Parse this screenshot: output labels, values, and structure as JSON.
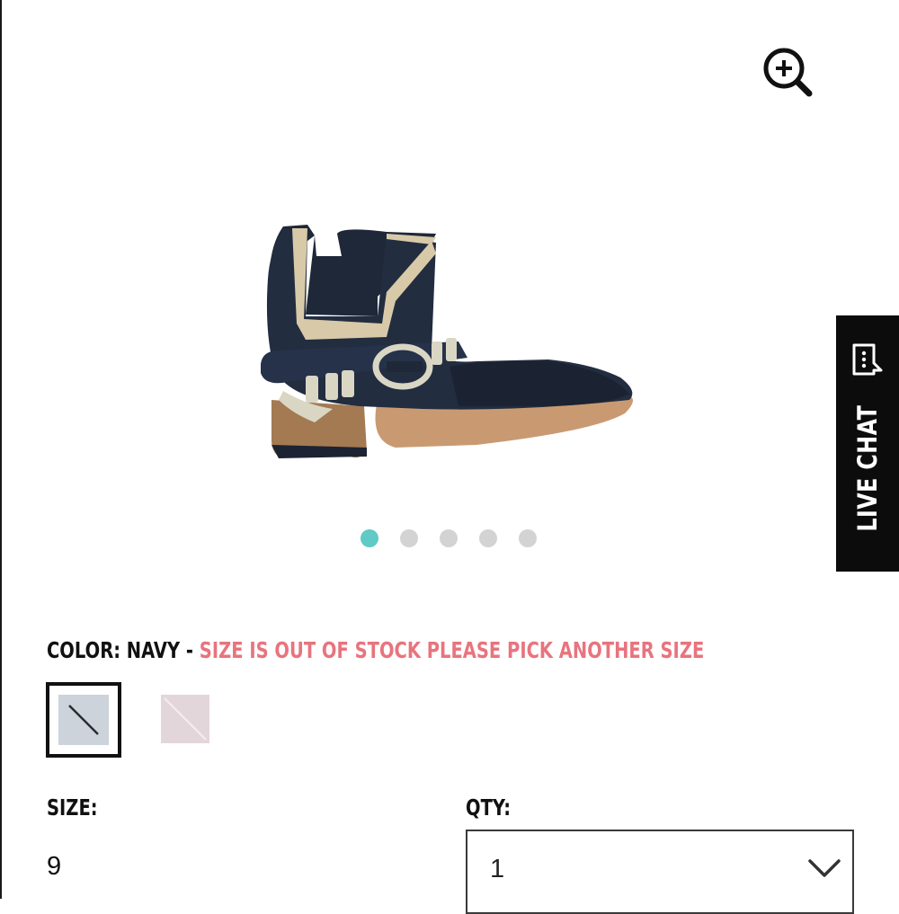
{
  "gallery": {
    "zoom_icon": "zoom-in-icon",
    "image_alt": "Navy cut-out ankle bootie with buckle strap",
    "slide_count": 5,
    "active_slide": 1,
    "active_dot_color": "#5fcac6",
    "inactive_dot_color": "#d3d3d3"
  },
  "live_chat": {
    "label": "LIVE CHAT",
    "icon": "chat-bubble-icon",
    "background": "#0c0c0c"
  },
  "color_selector": {
    "label": "COLOR: NAVY",
    "separator": " - ",
    "warning": "SIZE IS OUT OF STOCK PLEASE PICK ANOTHER SIZE",
    "warning_color": "#e8747e",
    "swatches": [
      {
        "name": "NAVY",
        "selected": true,
        "color": "#cdd3da"
      },
      {
        "name": "BLUSH",
        "selected": false,
        "color": "#e3d6da"
      }
    ]
  },
  "size": {
    "label": "SIZE:",
    "value": "9"
  },
  "qty": {
    "label": "QTY:",
    "value": "1",
    "icon": "chevron-down-icon"
  }
}
